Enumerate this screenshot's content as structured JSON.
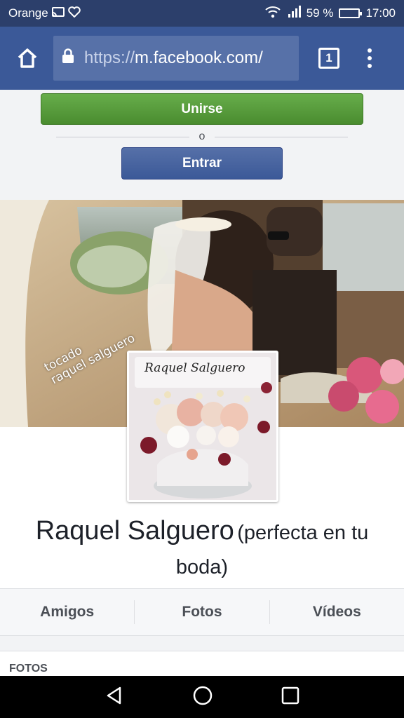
{
  "status_bar": {
    "carrier": "Orange",
    "battery_percent": "59 %",
    "battery_level": 0.59,
    "time": "17:00"
  },
  "browser": {
    "url_protocol": "https://",
    "url_host": "m.facebook.com/",
    "tab_count": "1"
  },
  "login": {
    "join_label": "Unirse",
    "or_label": "o",
    "login_label": "Entrar"
  },
  "cover": {
    "caption_line1": "tocado",
    "caption_line2": "raquel salguero"
  },
  "avatar": {
    "signature": "Raquel Salguero"
  },
  "profile": {
    "name": "Raquel Salguero",
    "subtitle_line1": "(perfecta en tu",
    "subtitle_line2": "boda)"
  },
  "tabs": [
    {
      "label": "Amigos"
    },
    {
      "label": "Fotos"
    },
    {
      "label": "Vídeos"
    }
  ],
  "photos_section": {
    "title": "FOTOS"
  },
  "colors": {
    "facebook_blue": "#3b5998",
    "status_bar": "#2c3f6b",
    "join_green": "#4a8c2f"
  },
  "icons": {
    "home": "home-icon",
    "lock": "lock-icon",
    "menu": "overflow-menu-icon",
    "back": "nav-back-icon",
    "home_nav": "nav-home-icon",
    "recents": "nav-recents-icon"
  }
}
